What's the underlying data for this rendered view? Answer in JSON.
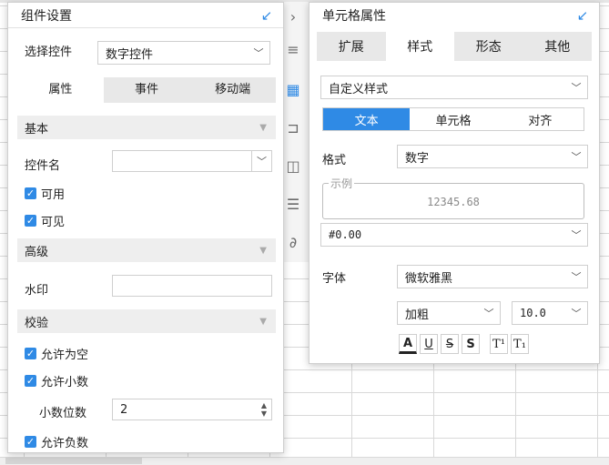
{
  "left_panel": {
    "title": "组件设置",
    "select_widget": {
      "label": "选择控件",
      "value": "数字控件"
    },
    "tabs": [
      {
        "label": "属性",
        "active": true
      },
      {
        "label": "事件",
        "active": false
      },
      {
        "label": "移动端",
        "active": false
      }
    ],
    "basic": {
      "header": "基本",
      "widget_name_label": "控件名",
      "widget_name_value": "",
      "checks": [
        {
          "label": "可用",
          "checked": true
        },
        {
          "label": "可见",
          "checked": true
        }
      ]
    },
    "advanced": {
      "header": "高级",
      "watermark_label": "水印",
      "watermark_value": ""
    },
    "validation": {
      "header": "校验",
      "allow_empty": "允许为空",
      "allow_decimal": "允许小数",
      "decimal_places_label": "小数位数",
      "decimal_places_value": "2",
      "allow_negative": "允许负数"
    }
  },
  "right_panel": {
    "title": "单元格属性",
    "tabs": [
      {
        "label": "扩展",
        "active": false
      },
      {
        "label": "样式",
        "active": true
      },
      {
        "label": "形态",
        "active": false
      },
      {
        "label": "其他",
        "active": false
      }
    ],
    "style_select": "自定义样式",
    "segments": [
      {
        "label": "文本",
        "active": true
      },
      {
        "label": "单元格",
        "active": false
      },
      {
        "label": "对齐",
        "active": false
      }
    ],
    "format_label": "格式",
    "format_value": "数字",
    "example_legend": "示例",
    "example_value": "12345.68",
    "pattern_value": "#0.00",
    "font_label": "字体",
    "font_value": "微软雅黑",
    "weight_value": "加粗",
    "size_value": "10.0",
    "format_buttons": {
      "color": "A",
      "underline": "U",
      "strike": "S",
      "shadow": "S",
      "superscript": "T¹",
      "subscript": "T₁"
    }
  },
  "colors": {
    "accent": "#2f8ae5"
  }
}
